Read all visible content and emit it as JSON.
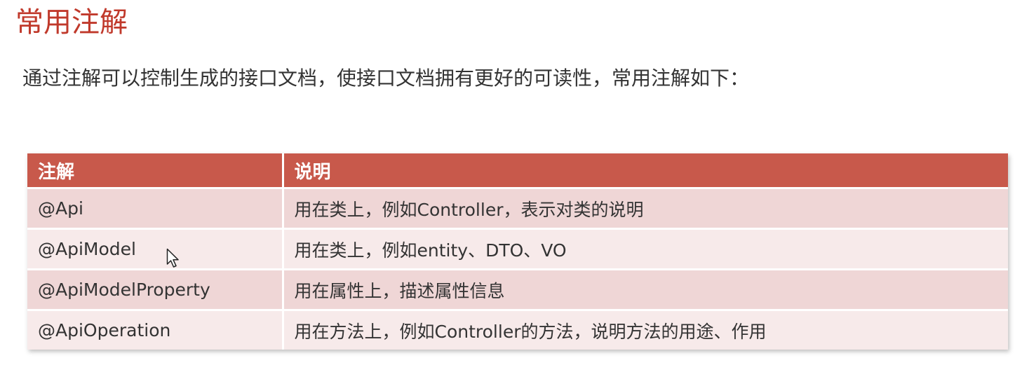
{
  "title": "常用注解",
  "intro": "通过注解可以控制生成的接口文档，使接口文档拥有更好的可读性，常用注解如下：",
  "table": {
    "headers": [
      "注解",
      "说明"
    ],
    "rows": [
      {
        "name": "@Api",
        "desc": "用在类上，例如Controller，表示对类的说明"
      },
      {
        "name": "@ApiModel",
        "desc": "用在类上，例如entity、DTO、VO"
      },
      {
        "name": "@ApiModelProperty",
        "desc": "用在属性上，描述属性信息"
      },
      {
        "name": "@ApiOperation",
        "desc": "用在方法上，例如Controller的方法，说明方法的用途、作用"
      }
    ]
  },
  "colors": {
    "title": "#c0392b",
    "header_bg": "#c8594b",
    "row_odd_bg": "#efd6d6",
    "row_even_bg": "#f7eaea"
  },
  "icons": {
    "cursor": "mouse-pointer-icon"
  }
}
